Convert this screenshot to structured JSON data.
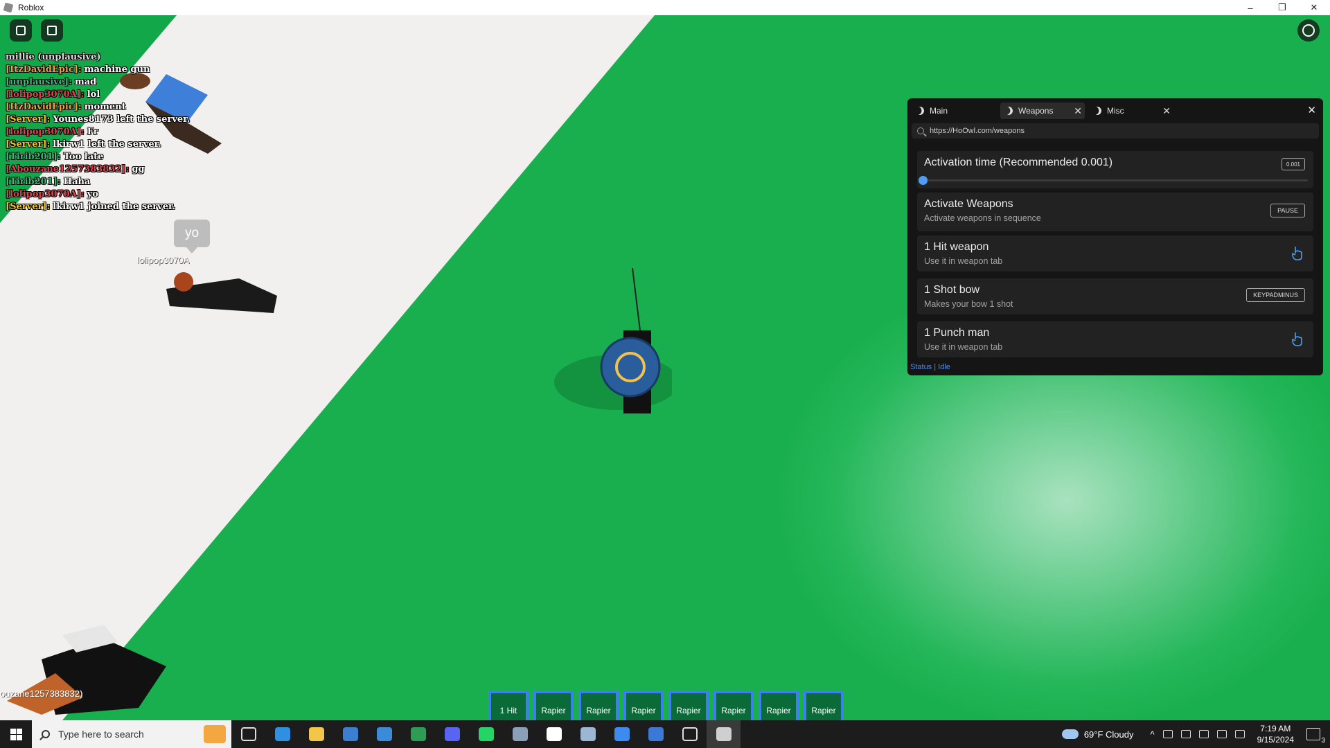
{
  "window": {
    "title": "Roblox",
    "controls": [
      "–",
      "❐",
      "✕"
    ]
  },
  "game": {
    "chat": [
      {
        "who": "millie (unplausive)",
        "msg": "",
        "color": "#d9d9d9"
      },
      {
        "who": "[ItzDavidEpic]:",
        "msg": "machine gun",
        "color": "#e8a33a"
      },
      {
        "who": "[unplausive]:",
        "msg": "mad",
        "color": "#3cb878"
      },
      {
        "who": "[lolipop3070A]:",
        "msg": "lol",
        "color": "#e0434c"
      },
      {
        "who": "[ItzDavidEpic]:",
        "msg": "moment",
        "color": "#e8a33a"
      },
      {
        "who": "[Server]:",
        "msg": "Younes8173 left the server.",
        "color": "#f0c419"
      },
      {
        "who": "[lolipop3070A]:",
        "msg": "Fr",
        "color": "#e0434c"
      },
      {
        "who": "[Server]:",
        "msg": "lkirw1 left the server.",
        "color": "#f0c419"
      },
      {
        "who": "[Tirib201]:",
        "msg": "Too late",
        "color": "#3cb878"
      },
      {
        "who": "[Abouzane1257383832]:",
        "msg": "gg",
        "color": "#e0434c"
      },
      {
        "who": "[Tirib201]:",
        "msg": "Haha",
        "color": "#3cb878"
      },
      {
        "who": "[lolipop3070A]:",
        "msg": "yo",
        "color": "#e0434c"
      },
      {
        "who": "[Server]:",
        "msg": "lkirw1 joined the server.",
        "color": "#f0c419"
      }
    ],
    "speech_bubble": "yo",
    "nametags": {
      "player_on_ground": "lolipop3070A",
      "player_bottom_left": "ouzane1257383832)"
    },
    "hotbar": [
      "1 Hit",
      "Rapier",
      "Rapier",
      "Rapier",
      "Rapier",
      "Rapier",
      "Rapier",
      "Rapier"
    ]
  },
  "panel": {
    "tabs": [
      {
        "label": "Main",
        "active": false,
        "closable": false
      },
      {
        "label": "Weapons",
        "active": true,
        "closable": true
      },
      {
        "label": "Misc",
        "active": false,
        "closable": true
      }
    ],
    "url": "https://HoOwl.com/weapons",
    "slider": {
      "title": "Activation time (Recommended 0.001)",
      "value_label": "0.001",
      "value_fraction": 0.0
    },
    "items": [
      {
        "title": "Activate Weapons",
        "subtitle": "Activate weapons in sequence",
        "control": "PAUSE"
      },
      {
        "title": "1 Hit weapon",
        "subtitle": "Use it in weapon tab",
        "control": "hand-icon"
      },
      {
        "title": "1 Shot bow",
        "subtitle": "Makes your bow 1 shot",
        "control": "KEYPADMINUS"
      },
      {
        "title": "1 Punch man",
        "subtitle": "Use it in weapon tab",
        "control": "hand-icon"
      }
    ],
    "status": "Status | Idle",
    "accent": "#4f9cf2"
  },
  "taskbar": {
    "search_placeholder": "Type here to search",
    "weather": "69°F  Cloudy",
    "time": "7:19 AM",
    "date": "9/15/2024",
    "notifications": "3",
    "apps": [
      "task-view-icon",
      "edge-icon",
      "file-explorer-icon",
      "store-icon",
      "mail-icon",
      "h-app-icon",
      "discord-icon",
      "whatsapp-icon",
      "app-icon",
      "security-icon",
      "notepad-icon",
      "snipping-tool-icon",
      "window-app-icon",
      "star-app-icon",
      "roblox-icon"
    ]
  }
}
